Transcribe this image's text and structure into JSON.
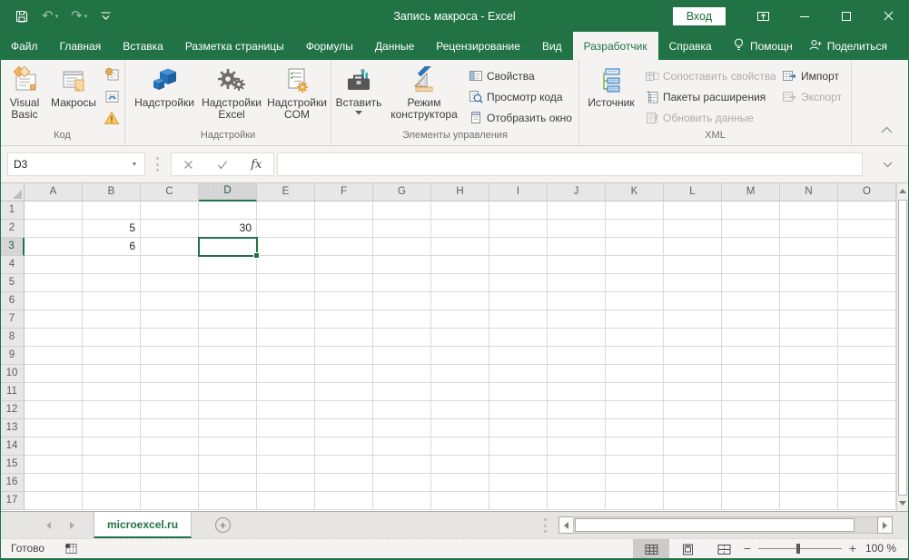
{
  "colors": {
    "accent_green": "#217346"
  },
  "titlebar": {
    "title": "Запись макроса - Excel",
    "signin_label": "Вход"
  },
  "ribbon_tabs": [
    {
      "label": "Файл"
    },
    {
      "label": "Главная"
    },
    {
      "label": "Вставка"
    },
    {
      "label": "Разметка страницы"
    },
    {
      "label": "Формулы"
    },
    {
      "label": "Данные"
    },
    {
      "label": "Рецензирование"
    },
    {
      "label": "Вид"
    },
    {
      "label": "Разработчик",
      "active": true
    },
    {
      "label": "Справка"
    }
  ],
  "tab_extras": {
    "help": "Помощн",
    "share": "Поделиться"
  },
  "ribbon": {
    "code_group": {
      "label": "Код",
      "visual_basic": "Visual Basic",
      "macros": "Макросы"
    },
    "addins_group": {
      "label": "Надстройки",
      "addins": "Надстройки",
      "excel_addins": "Надстройки Excel",
      "com_addins": "Надстройки COM"
    },
    "controls_group": {
      "label": "Элементы управления",
      "insert": "Вставить",
      "design_mode": "Режим конструктора",
      "properties": "Свойства",
      "view_code": "Просмотр кода",
      "run_dialog": "Отобразить окно"
    },
    "xml_group": {
      "label": "XML",
      "source": "Источник",
      "map_properties": "Сопоставить свойства",
      "expansion_packs": "Пакеты расширения",
      "refresh_data": "Обновить данные",
      "import": "Импорт",
      "export": "Экспорт"
    }
  },
  "formula_bar": {
    "name_box": "D3",
    "fx": "fx",
    "formula_value": ""
  },
  "grid": {
    "columns": [
      "A",
      "B",
      "C",
      "D",
      "E",
      "F",
      "G",
      "H",
      "I",
      "J",
      "K",
      "L",
      "M",
      "N",
      "O"
    ],
    "row_count": 17,
    "cells": {
      "B2": "5",
      "B3": "6",
      "D2": "30"
    },
    "active_cell": "D3",
    "selected_column": "D",
    "selected_row": 3
  },
  "sheet_bar": {
    "tab": "microexcel.ru"
  },
  "status_bar": {
    "ready": "Готово",
    "zoom": "100 %"
  }
}
